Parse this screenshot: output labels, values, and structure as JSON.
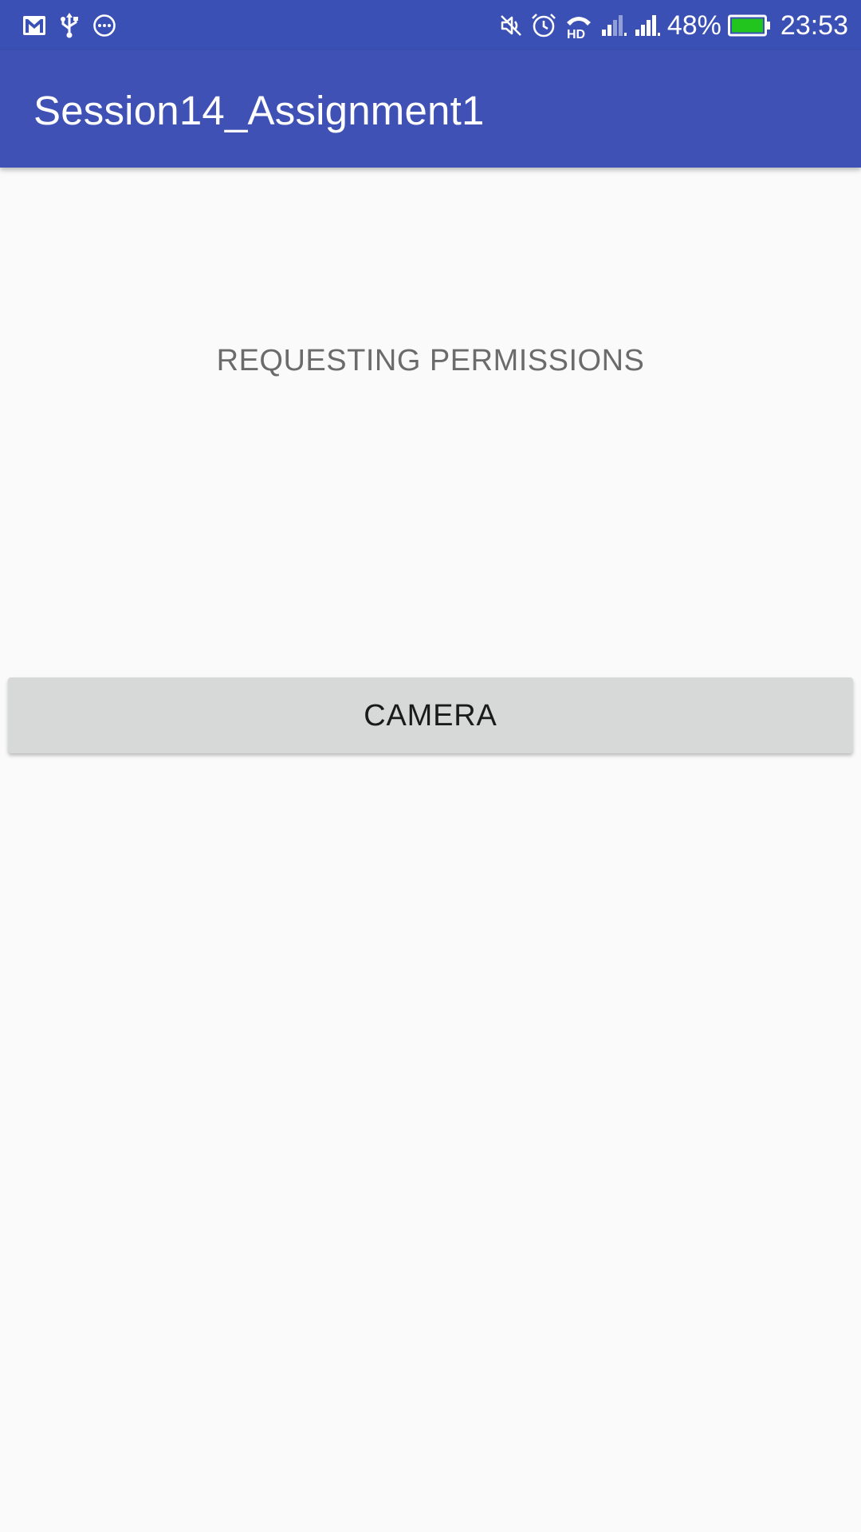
{
  "status_bar": {
    "left_icons": [
      "gmail-icon",
      "usb-icon",
      "more-icon"
    ],
    "right_icons": [
      "mute-icon",
      "alarm-icon",
      "hd-call-icon",
      "signal-1-icon",
      "signal-2-icon",
      "battery-icon"
    ],
    "battery_percent": "48%",
    "time": "23:53",
    "battery_color": "#22c41e",
    "background": "#3a50b5"
  },
  "app_bar": {
    "title": "Session14_Assignment1",
    "background": "#3f51b5"
  },
  "main": {
    "permission_text": "REQUESTING PERMISSIONS",
    "camera_button_label": "CAMERA"
  }
}
